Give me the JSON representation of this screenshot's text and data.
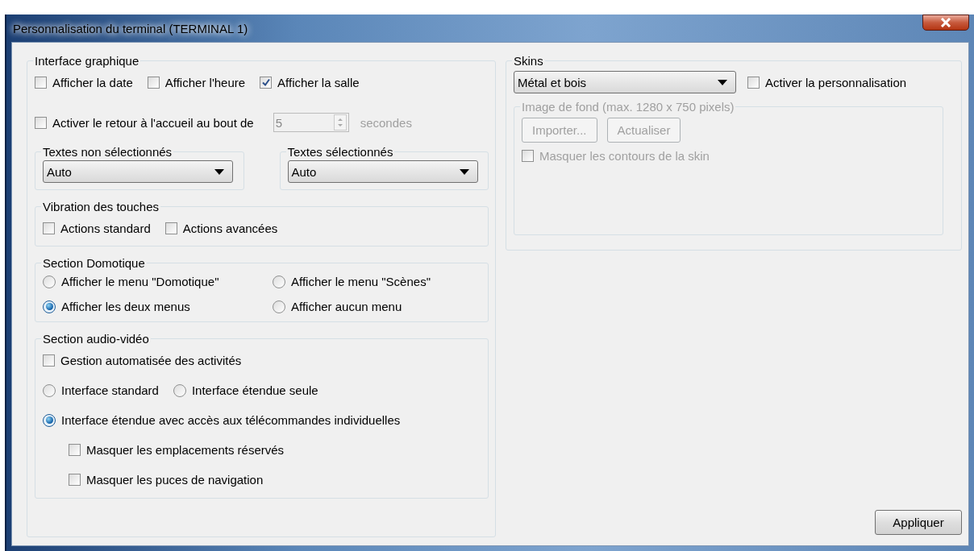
{
  "window": {
    "title": "Personnalisation du terminal (TERMINAL 1)"
  },
  "graphics": {
    "title": "Interface graphique",
    "checkboxes": [
      {
        "label": "Afficher la date",
        "checked": false
      },
      {
        "label": "Afficher l'heure",
        "checked": false
      },
      {
        "label": "Afficher la salle",
        "checked": true
      }
    ],
    "return_home": {
      "label": "Activer le retour à l'accueil au bout de",
      "checked": false,
      "value": "5",
      "unit": "secondes",
      "disabled": true
    },
    "text_groups": [
      {
        "title": "Textes non sélectionnés",
        "value": "Auto"
      },
      {
        "title": "Textes sélectionnés",
        "value": "Auto"
      }
    ],
    "vibration": {
      "title": "Vibration des touches",
      "options": [
        {
          "label": "Actions standard",
          "checked": false
        },
        {
          "label": "Actions avancées",
          "checked": false
        }
      ]
    },
    "domotique": {
      "title": "Section Domotique",
      "options": [
        {
          "label": "Afficher le menu \"Domotique\"",
          "selected": false
        },
        {
          "label": "Afficher le menu \"Scènes\"",
          "selected": false
        },
        {
          "label": "Afficher les deux menus",
          "selected": true
        },
        {
          "label": "Afficher aucun menu",
          "selected": false
        }
      ]
    },
    "audio_video": {
      "title": "Section audio-vidéo",
      "rows": [
        {
          "kind": "checkbox",
          "label": "Gestion automatisée des activités",
          "checked": false
        },
        {
          "kind": "radios",
          "options": [
            {
              "label": "Interface standard",
              "selected": false
            },
            {
              "label": "Interface étendue seule",
              "selected": false
            }
          ]
        },
        {
          "kind": "radio",
          "label": "Interface étendue avec accès aux télécommandes individuelles",
          "selected": true,
          "children": [
            {
              "label": "Masquer les emplacements réservés",
              "checked": false
            },
            {
              "label": "Masquer les puces de navigation",
              "checked": false
            }
          ]
        }
      ]
    }
  },
  "skins": {
    "title": "Skins",
    "value": "Métal et bois",
    "custom": {
      "label": "Activer la personnalisation",
      "checked": false
    },
    "background": {
      "title": "Image de fond (max. 1280 x 750 pixels)",
      "disabled": true,
      "buttons": [
        "Importer...",
        "Actualiser"
      ],
      "hide_outline": {
        "label": "Masquer les contours de la skin",
        "checked": false
      }
    }
  },
  "apply_button": "Appliquer"
}
